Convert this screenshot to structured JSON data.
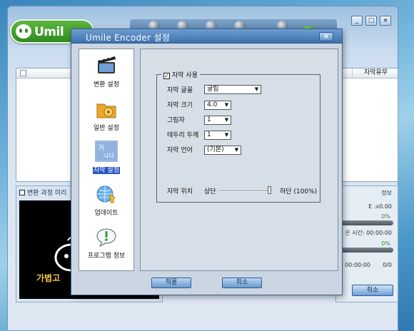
{
  "main_window": {
    "logo_text": "Umil",
    "window_buttons": [
      "_",
      "□",
      "×"
    ],
    "list_header": {
      "subtitle_col": "자막유무"
    },
    "preview": {
      "title": "변환 과정 미리",
      "splash_text": "가볍고"
    },
    "info": {
      "title": "정보",
      "speed": "E :x0.00",
      "pct1": "0%",
      "remaining": "은 시간: 00:00:00",
      "pct2": "0%",
      "elapsed": "00:00:00",
      "count": "0/0"
    },
    "cancel_label": "취소"
  },
  "dialog": {
    "title": "Umile Encoder 설정",
    "close": "×",
    "sidebar": [
      {
        "label": "변환 설정",
        "icon": "video-icon"
      },
      {
        "label": "일반 설정",
        "icon": "folder-gear-icon"
      },
      {
        "label": "자막 설정",
        "icon": "subtitle-icon",
        "active": true
      },
      {
        "label": "업데이트",
        "icon": "globe-update-icon"
      },
      {
        "label": "프로그램 정보",
        "icon": "info-bubble-icon"
      }
    ],
    "subtitle": {
      "enable_label": "자막 사용",
      "enable_checked": "☑",
      "font_label": "자막 글꼴",
      "font_value": "굴림",
      "size_label": "자막 크기",
      "size_value": "4.0",
      "shadow_label": "그림자",
      "shadow_value": "1",
      "border_label": "테두리 두께",
      "border_value": "1",
      "lang_label": "자막 언어",
      "lang_value": "(기본)",
      "pos_label": "자막 위치",
      "pos_top": "상단",
      "pos_bottom": "하단  (100%)",
      "position_fraction": 1.0
    },
    "ok_label": "적용",
    "cancel_label": "취소"
  }
}
